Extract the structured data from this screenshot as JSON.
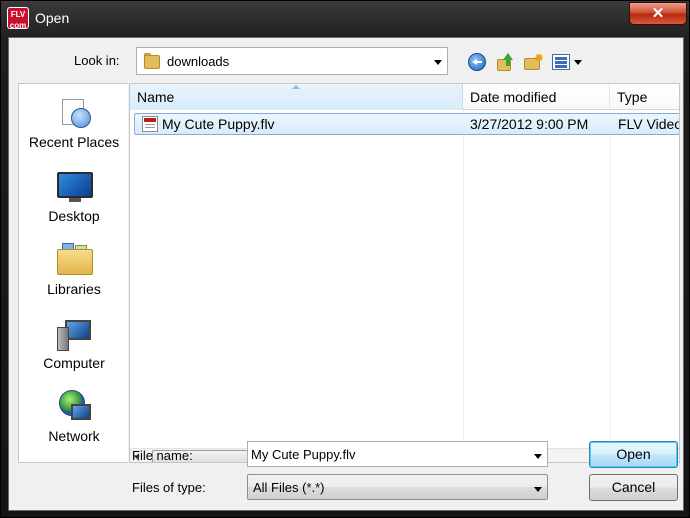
{
  "window": {
    "app_icon_text": "FLV com",
    "title": "Open",
    "close_glyph": "✕"
  },
  "toolbar": {
    "look_in_label": "Look in:",
    "look_in_value": "downloads",
    "icons": [
      "back-icon",
      "up-one-level-icon",
      "new-folder-icon",
      "views-menu-icon"
    ]
  },
  "places": [
    {
      "label": "Recent Places",
      "icon": "recent-places-icon"
    },
    {
      "label": "Desktop",
      "icon": "desktop-icon"
    },
    {
      "label": "Libraries",
      "icon": "libraries-icon"
    },
    {
      "label": "Computer",
      "icon": "computer-icon"
    },
    {
      "label": "Network",
      "icon": "network-icon"
    }
  ],
  "file_list": {
    "columns": [
      "Name",
      "Date modified",
      "Type"
    ],
    "sorted_by": "Name",
    "rows": [
      {
        "name": "My Cute Puppy.flv",
        "date_modified": "3/27/2012 9:00 PM",
        "type": "FLV Video",
        "selected": true,
        "icon": "flv-file-icon"
      }
    ]
  },
  "form": {
    "file_name_label": "File name:",
    "file_name_value": "My Cute Puppy.flv",
    "files_of_type_label": "Files of type:",
    "files_of_type_value": "All Files (*.*)"
  },
  "buttons": {
    "open": "Open",
    "cancel": "Cancel"
  },
  "colors": {
    "selection_border": "#84acdd",
    "close_button": "#c9391a",
    "default_button_border": "#3c7fb1"
  }
}
